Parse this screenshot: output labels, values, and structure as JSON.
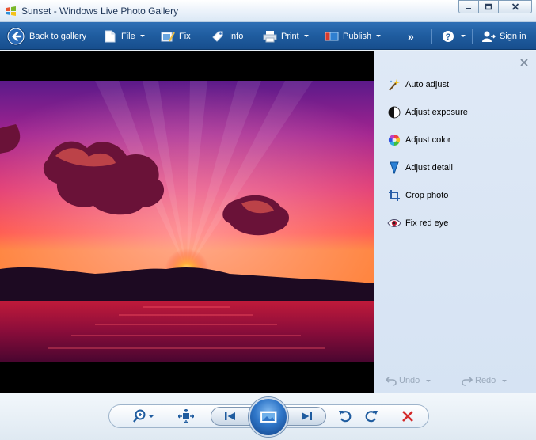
{
  "window": {
    "title": "Sunset - Windows Live Photo Gallery",
    "buttons": {
      "minimize": "minimize",
      "maximize": "maximize",
      "close": "close"
    }
  },
  "toolbar": {
    "back_label": "Back to gallery",
    "file_label": "File",
    "fix_label": "Fix",
    "info_label": "Info",
    "print_label": "Print",
    "publish_label": "Publish",
    "overflow_label": "»",
    "help_label": "?",
    "signin_label": "Sign in"
  },
  "photo": {
    "subject": "sunset over water with pink clouds"
  },
  "fix_pane": {
    "items": [
      {
        "label": "Auto adjust",
        "icon": "magic-wand-icon"
      },
      {
        "label": "Adjust exposure",
        "icon": "exposure-icon"
      },
      {
        "label": "Adjust color",
        "icon": "color-wheel-icon"
      },
      {
        "label": "Adjust detail",
        "icon": "detail-icon"
      },
      {
        "label": "Crop photo",
        "icon": "crop-icon"
      },
      {
        "label": "Fix red eye",
        "icon": "red-eye-icon"
      }
    ],
    "undo_label": "Undo",
    "redo_label": "Redo"
  },
  "controls": {
    "zoom": "zoom-icon",
    "fit": "actual-size-icon",
    "previous": "previous-icon",
    "slideshow": "slideshow-icon",
    "next": "next-icon",
    "rotate_left": "rotate-counterclockwise-icon",
    "rotate_right": "rotate-clockwise-icon",
    "delete": "delete-icon"
  },
  "colors": {
    "toolbar": "#1f5c9f",
    "pane": "#dfe9f6",
    "delete": "#d42a2a"
  }
}
